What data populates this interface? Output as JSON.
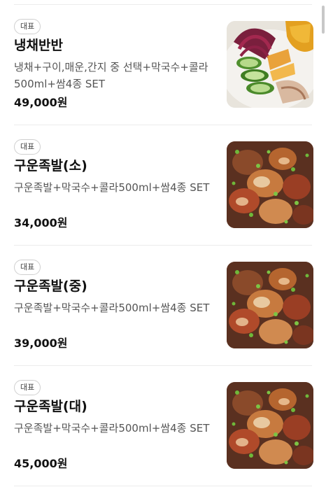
{
  "menu": {
    "items": [
      {
        "badge": "대표",
        "name": "냉채반반",
        "description": "냉채+구이,매운,간지 중 선택+막국수+콜라500ml+쌈4종 SET",
        "price": "49,000원",
        "image_icon": "cold-salad-food-photo-icon"
      },
      {
        "badge": "대표",
        "name": "구운족발(소)",
        "description": "구운족발+막국수+콜라500ml+쌈4종 SET",
        "price": "34,000원",
        "image_icon": "grilled-pork-feet-photo-icon"
      },
      {
        "badge": "대표",
        "name": "구운족발(중)",
        "description": "구운족발+막국수+콜라500ml+쌈4종 SET",
        "price": "39,000원",
        "image_icon": "grilled-pork-feet-photo-icon"
      },
      {
        "badge": "대표",
        "name": "구운족발(대)",
        "description": "구운족발+막국수+콜라500ml+쌈4종 SET",
        "price": "45,000원",
        "image_icon": "grilled-pork-feet-photo-icon"
      }
    ]
  }
}
